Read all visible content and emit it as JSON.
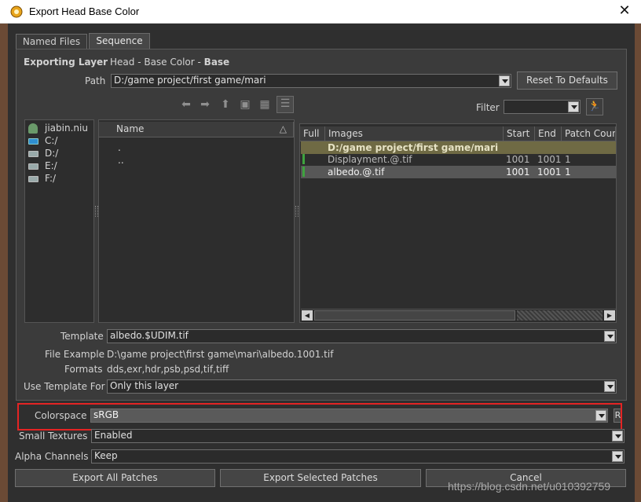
{
  "window": {
    "title": "Export Head Base Color",
    "close_glyph": "✕"
  },
  "tabs": [
    {
      "label": "Named Files",
      "active": false
    },
    {
      "label": "Sequence",
      "active": true
    }
  ],
  "exporting_layer": {
    "label": "Exporting Layer",
    "value_prefix": "Head - Base Color - ",
    "value_bold": "Base"
  },
  "path": {
    "label": "Path",
    "value": "D:/game project/first game/mari"
  },
  "reset_button": "Reset To Defaults",
  "filter": {
    "label": "Filter",
    "value": ""
  },
  "toolbar_icons": [
    "back-arrow-icon",
    "forward-arrow-icon",
    "up-arrow-icon",
    "new-folder-icon",
    "grid-view-icon",
    "list-view-icon"
  ],
  "drives": [
    "jiabin.niu",
    "C:/",
    "D:/",
    "E:/",
    "F:/"
  ],
  "folder_list": {
    "header": "Name",
    "items": [
      ".",
      ".."
    ]
  },
  "images_table": {
    "headers": [
      "Full",
      "Images",
      "Start",
      "End",
      "Patch Coun"
    ],
    "group_row": "D:/game project/first game/mari",
    "rows": [
      {
        "image": "Displayment.@.tif",
        "start": "1001",
        "end": "1001",
        "patches": "1",
        "selected": false
      },
      {
        "image": "albedo.@.tif",
        "start": "1001",
        "end": "1001",
        "patches": "1",
        "selected": true
      }
    ]
  },
  "template": {
    "label": "Template",
    "value": "albedo.$UDIM.tif"
  },
  "file_example": {
    "label": "File Example",
    "value": "D:\\game project\\first game\\mari\\albedo.1001.tif"
  },
  "formats": {
    "label": "Formats",
    "value": "dds,exr,hdr,psb,psd,tif,tiff"
  },
  "use_template_for": {
    "label": "Use Template For",
    "value": "Only this layer"
  },
  "colorspace": {
    "label": "Colorspace",
    "value": "sRGB",
    "side_button": "R"
  },
  "small_textures": {
    "label": "Small Textures",
    "value": "Enabled"
  },
  "alpha_channels": {
    "label": "Alpha Channels",
    "value": "Keep"
  },
  "buttons": {
    "export_all": "Export All Patches",
    "export_selected": "Export Selected Patches",
    "cancel": "Cancel"
  },
  "watermark": "https://blog.csdn.net/u010392759",
  "colors": {
    "highlight": "#e42424",
    "group_row": "#6f6a44",
    "selected_row": "#575757",
    "accent_green": "#3fa33f"
  }
}
